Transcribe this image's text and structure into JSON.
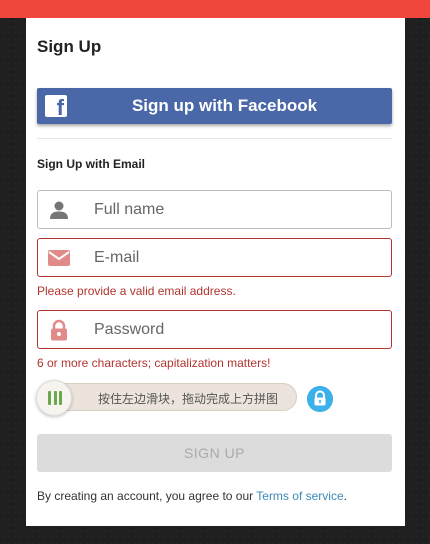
{
  "form": {
    "title": "Sign Up",
    "facebook_button": "Sign up with Facebook",
    "facebook_icon_glyph": "f",
    "email_heading": "Sign Up with Email",
    "fullname_placeholder": "Full name",
    "email_placeholder": "E-mail",
    "email_error": "Please provide a valid email address.",
    "password_placeholder": "Password",
    "password_error": "6 or more characters; capitalization matters!",
    "captcha_slider_text": "按住左边滑块，拖动完成上方拼图",
    "signup_button": "SIGN UP",
    "terms_prefix": "By creating an account, you agree to our ",
    "terms_link": "Terms of service",
    "terms_suffix": "."
  },
  "colors": {
    "top_bar": "#f1463c",
    "facebook": "#4a67a8",
    "error": "#b0352f",
    "link": "#3a8ab8",
    "lock_badge": "#3cb0ea",
    "slider_grip": "#6aa84f"
  },
  "icons": {
    "fullname": "person-icon",
    "email": "envelope-icon",
    "password": "lock-icon",
    "captcha": "lock-badge-icon",
    "facebook": "facebook-icon",
    "slider": "grip-bars-icon"
  }
}
